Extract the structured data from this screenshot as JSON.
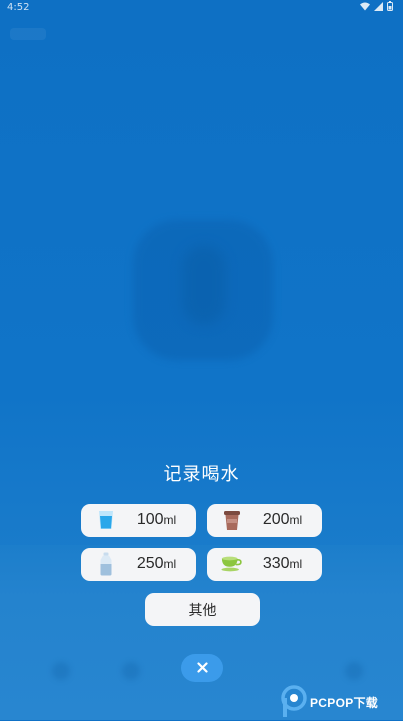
{
  "status_bar": {
    "time": "4:52",
    "icons": [
      "wifi-icon",
      "signal-icon",
      "battery-icon"
    ]
  },
  "dialog": {
    "title": "记录喝水",
    "options": [
      {
        "amount": "100",
        "unit": "ml",
        "icon": "water-glass-icon",
        "color": "#2aa7ea"
      },
      {
        "amount": "200",
        "unit": "ml",
        "icon": "coffee-cup-icon",
        "color": "#a86a5c"
      },
      {
        "amount": "250",
        "unit": "ml",
        "icon": "water-bottle-icon",
        "color": "#9fc0dd"
      },
      {
        "amount": "330",
        "unit": "ml",
        "icon": "tea-cup-icon",
        "color": "#8cc63f"
      }
    ],
    "other_label": "其他",
    "close_icon": "close-icon"
  },
  "watermark": {
    "text": "PCPOP下载"
  },
  "colors": {
    "background": "#0f71c6",
    "close_button": "#3b9bea",
    "button_bg": "#f4f5f7"
  }
}
